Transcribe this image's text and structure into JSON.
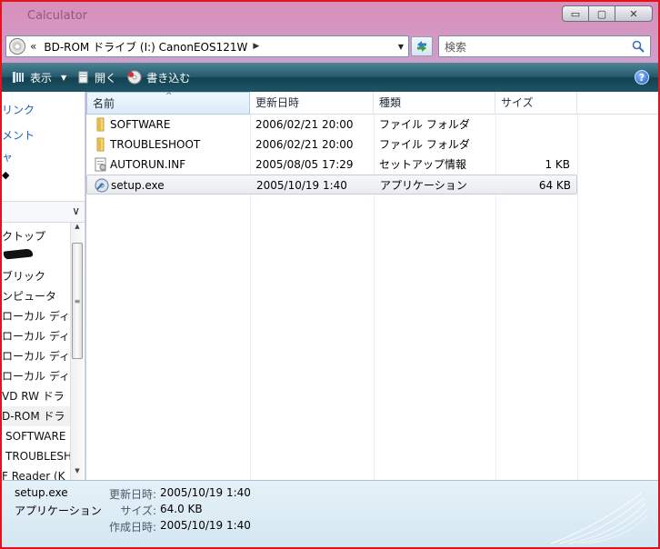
{
  "window": {
    "ghost_title": "Calculator"
  },
  "caption": {
    "minimize": "▭",
    "maximize": "▢",
    "close": "✕"
  },
  "address": {
    "chevron": "«",
    "path": "BD-ROM ドライブ (I:) CanonEOS121W",
    "arrow": "▶",
    "dropdown": "▼"
  },
  "search": {
    "placeholder": "検索"
  },
  "toolbar": {
    "view_label": "表示",
    "open_label": "開く",
    "burn_label": "書き込む",
    "dropdown_glyph": "▼",
    "help": "?"
  },
  "nav": {
    "links": [
      "リンク",
      "メント",
      "ャ"
    ],
    "mark_glyph": "◆",
    "collapse_glyph": "∨",
    "folders": [
      "クトップ",
      "",
      "ブリック",
      "ンピュータ",
      "ローカル ディ",
      "ローカル ディ",
      "ローカル ディ",
      "ローカル ディ",
      "VD RW ドラ",
      "D-ROM ドラ",
      "SOFTWARE",
      "TROUBLESH",
      "F Reader (K"
    ]
  },
  "columns": {
    "name": "名前",
    "date": "更新日時",
    "type": "種類",
    "size": "サイズ"
  },
  "files": [
    {
      "name": "SOFTWARE",
      "date": "2006/02/21 20:00",
      "type": "ファイル フォルダ",
      "size": "",
      "icon": "folder-icon"
    },
    {
      "name": "TROUBLESHOOT",
      "date": "2006/02/21 20:00",
      "type": "ファイル フォルダ",
      "size": "",
      "icon": "folder-icon"
    },
    {
      "name": "AUTORUN.INF",
      "date": "2005/08/05 17:29",
      "type": "セットアップ情報",
      "size": "1 KB",
      "icon": "setup-info-icon"
    },
    {
      "name": "setup.exe",
      "date": "2005/10/19 1:40",
      "type": "アプリケーション",
      "size": "64 KB",
      "icon": "setup-exe-icon"
    }
  ],
  "details": {
    "name": "setup.exe",
    "type": "アプリケーション",
    "modified_label": "更新日時:",
    "modified_value": "2005/10/19 1:40",
    "size_label": "サイズ:",
    "size_value": "64.0 KB",
    "created_label": "作成日時:",
    "created_value": "2005/10/19 1:40"
  },
  "colors": {
    "toolbar": "#255a6c",
    "accent_border": "#e0141e",
    "link": "#1c5ec0"
  }
}
